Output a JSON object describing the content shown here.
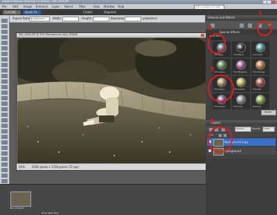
{
  "app": {
    "title": "Adobe Photoshop Elements 5.0 (Editor) - IMG_5506.JPG",
    "search_placeholder": "Type a question for help"
  },
  "menu": [
    "File",
    "Edit",
    "Image",
    "Enhance",
    "Layer",
    "Select",
    "Filter",
    "View",
    "Window",
    "Help"
  ],
  "shortcuts": {
    "full_edit": "Full Edit",
    "quick_fix": "Quick Fix",
    "create": "Create",
    "organize": "Organize"
  },
  "options": {
    "aspect_label": "Aspect Ratio:",
    "aspect_value": "No Restriction",
    "width_label": "Width:",
    "height_label": "Height:",
    "resolution_label": "Resolution:",
    "units": "pixels/inch"
  },
  "document": {
    "title": "IMG_5506.JPG @ 25% (Background copy, RGB/8)",
    "zoom": "25%",
    "doc_size": "2592 pixels x 1728 pixels (72 ppi)"
  },
  "panels": {
    "artwork_title": "Artwork and Effects",
    "special_effects": "Special Effects",
    "photo_effects_label": "Photo Effects",
    "effects": [
      {
        "label": "Tint Blue"
      },
      {
        "label": "Tint Black"
      },
      {
        "label": "Tint Cyan"
      },
      {
        "label": "Tint Green"
      },
      {
        "label": "Tint Magenta"
      },
      {
        "label": "Tint Orange"
      },
      {
        "label": "Tint Sepia"
      },
      {
        "label": "Tint Yellow"
      },
      {
        "label": "Tint Red"
      },
      {
        "label": "Tint Purple"
      },
      {
        "label": "Tint Gray"
      },
      {
        "label": "Glowing"
      }
    ],
    "apply_button": "Apply",
    "layers_title": "Layers",
    "blend_mode": "Normal",
    "opacity_label": "Opacity:",
    "opacity_value": "100%",
    "lock_label": "Lock:",
    "layers": [
      {
        "name": "Background copy",
        "selected": true
      },
      {
        "name": "Background",
        "selected": false
      }
    ]
  },
  "bin": {
    "thumb_label": "IMG_5506.JPG",
    "show_open_files": "Show Open Files"
  },
  "annotations": [
    "1",
    "2",
    "3",
    "4"
  ],
  "colors": {
    "annotation": "#e31b1b",
    "selection": "#3a6fc7",
    "workspace": "#5d5d5d"
  }
}
